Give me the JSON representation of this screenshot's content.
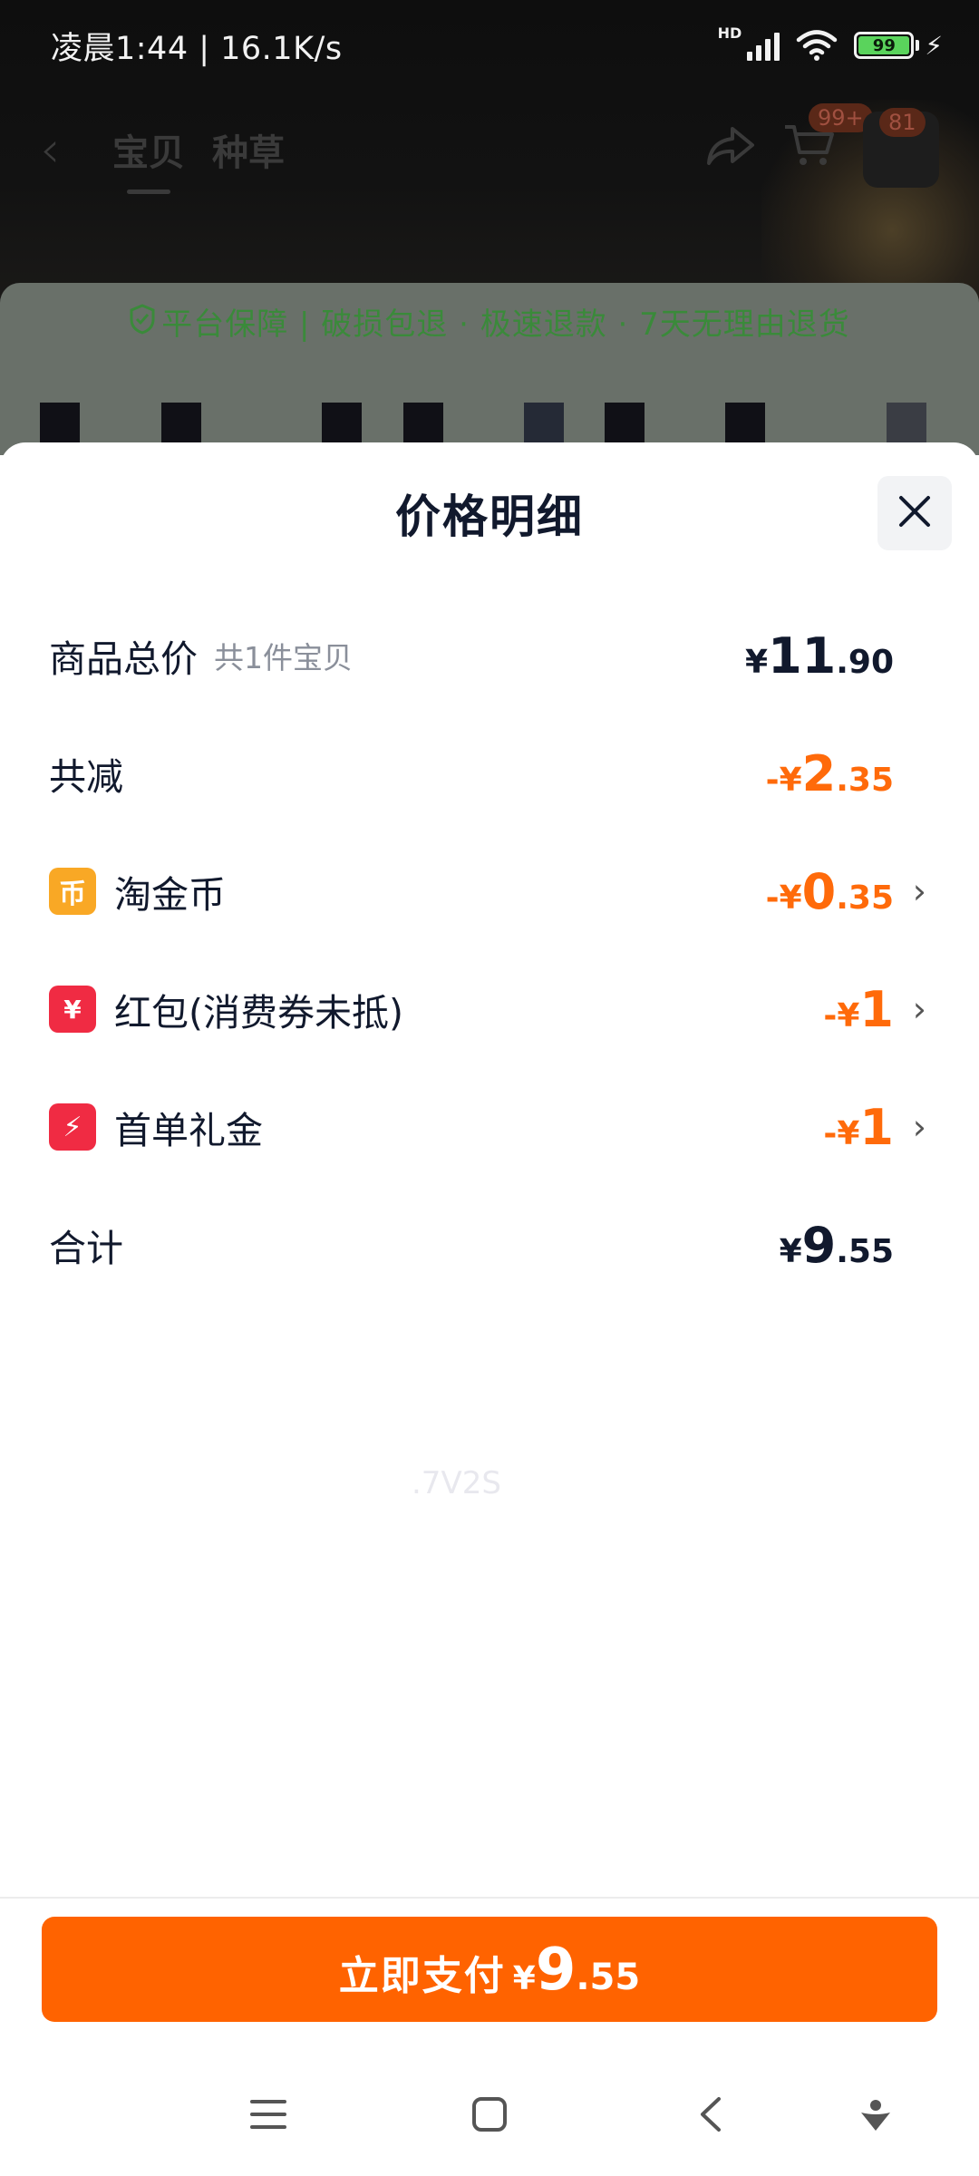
{
  "status_bar": {
    "time": "凌晨1:44 | 16.1K/s",
    "hd": "HD",
    "battery": "99"
  },
  "background": {
    "tabs": [
      "宝贝",
      "种草"
    ],
    "cart_badge": "99+",
    "msg_badge": "81",
    "guarantee": "平台保障 | 破损包退 · 极速退款 · 7天无理由退货"
  },
  "sheet": {
    "title": "价格明细",
    "rows": [
      {
        "label": "商品总价",
        "sub": "共1件宝贝",
        "sym": "¥",
        "int": "11",
        "dec": ".90",
        "tone": "dark"
      },
      {
        "label": "共减",
        "sym": "-¥",
        "int": "2",
        "dec": ".35",
        "tone": "orange"
      },
      {
        "label": "淘金币",
        "icon": "coin-icon",
        "sym": "-¥",
        "int": "0",
        "dec": ".35",
        "tone": "orange"
      },
      {
        "label": "红包(消费券未抵)",
        "icon": "red-packet-icon",
        "sym": "-¥",
        "int": "1",
        "dec": "",
        "tone": "orange"
      },
      {
        "label": "首单礼金",
        "icon": "gift-cash-icon",
        "sym": "-¥",
        "int": "1",
        "dec": "",
        "tone": "orange"
      },
      {
        "label": "合计",
        "sym": "¥",
        "int": "9",
        "dec": ".55",
        "tone": "dark"
      }
    ],
    "watermark": ".7V2S"
  },
  "pay": {
    "label": "立即支付",
    "sym": "¥",
    "int": "9",
    "dec": ".55"
  },
  "colors": {
    "accent": "#ff6300",
    "discount": "#ff6a0a",
    "text": "#11192d"
  }
}
